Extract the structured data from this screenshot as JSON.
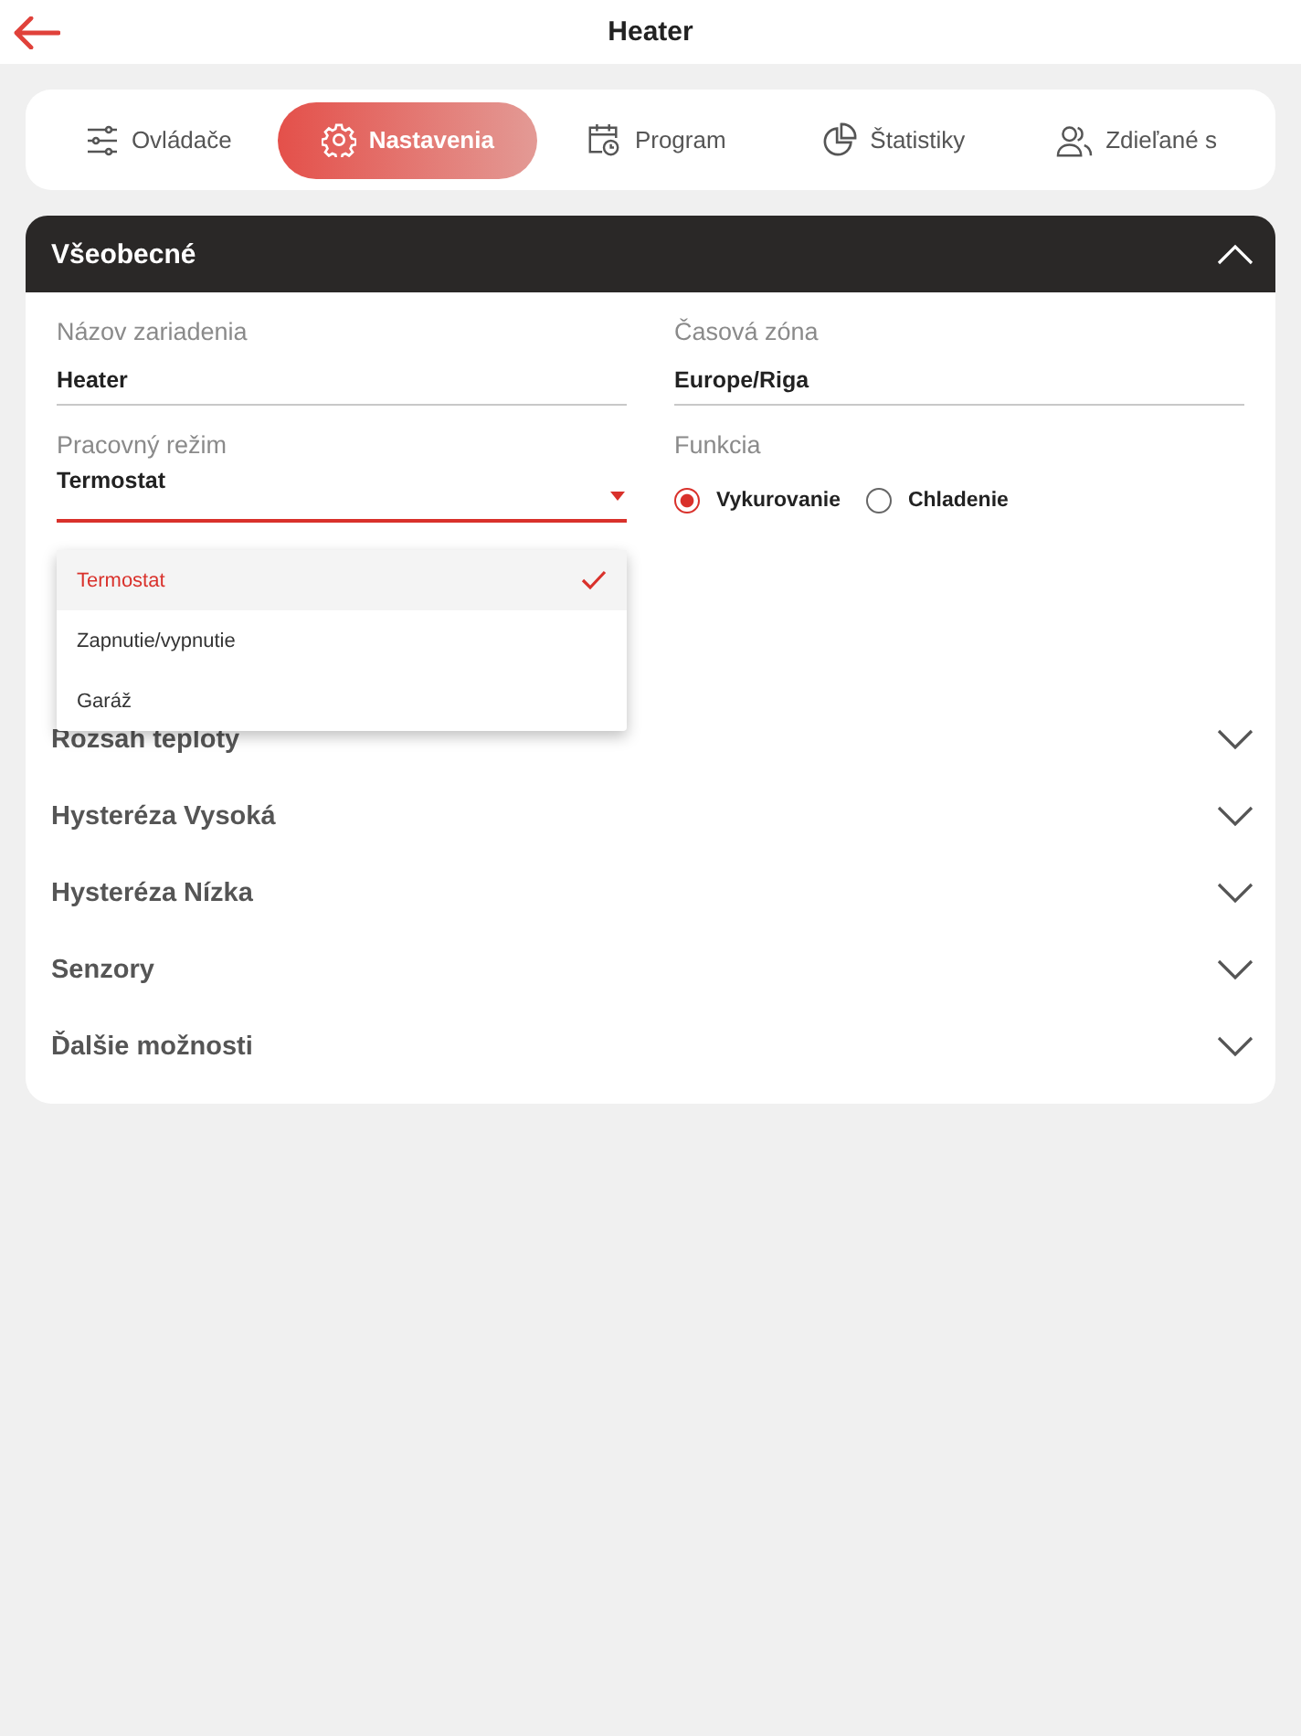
{
  "header": {
    "title": "Heater"
  },
  "tabs": [
    {
      "label": "Ovládače",
      "selected": false
    },
    {
      "label": "Nastavenia",
      "selected": true
    },
    {
      "label": "Program",
      "selected": false
    },
    {
      "label": "Štatistiky",
      "selected": false
    },
    {
      "label": "Zdieľané s",
      "selected": false
    }
  ],
  "section": {
    "title": "Všeobecné",
    "expanded": true,
    "fields": [
      {
        "label": "Názov zariadenia",
        "value": "Heater"
      },
      {
        "label": "Časová zóna",
        "value": "Europe/Riga"
      }
    ],
    "mode": {
      "label": "Pracovný režim",
      "value": "Termostat",
      "open": true,
      "options": [
        {
          "label": "Termostat",
          "selected": true
        },
        {
          "label": "Zapnutie/vypnutie",
          "selected": false
        },
        {
          "label": "Garáž",
          "selected": false
        }
      ]
    },
    "function": {
      "label": "Funkcia",
      "options": [
        {
          "label": "Vykurovanie",
          "selected": true
        },
        {
          "label": "Chladenie",
          "selected": false
        }
      ]
    }
  },
  "accordions": [
    {
      "title": "Rozsah teploty",
      "expanded": false
    },
    {
      "title": "Hysteréza Vysoká",
      "expanded": false
    },
    {
      "title": "Hysteréza Nízka",
      "expanded": false
    },
    {
      "title": "Senzory",
      "expanded": false
    },
    {
      "title": "Ďalšie možnosti",
      "expanded": false
    }
  ]
}
